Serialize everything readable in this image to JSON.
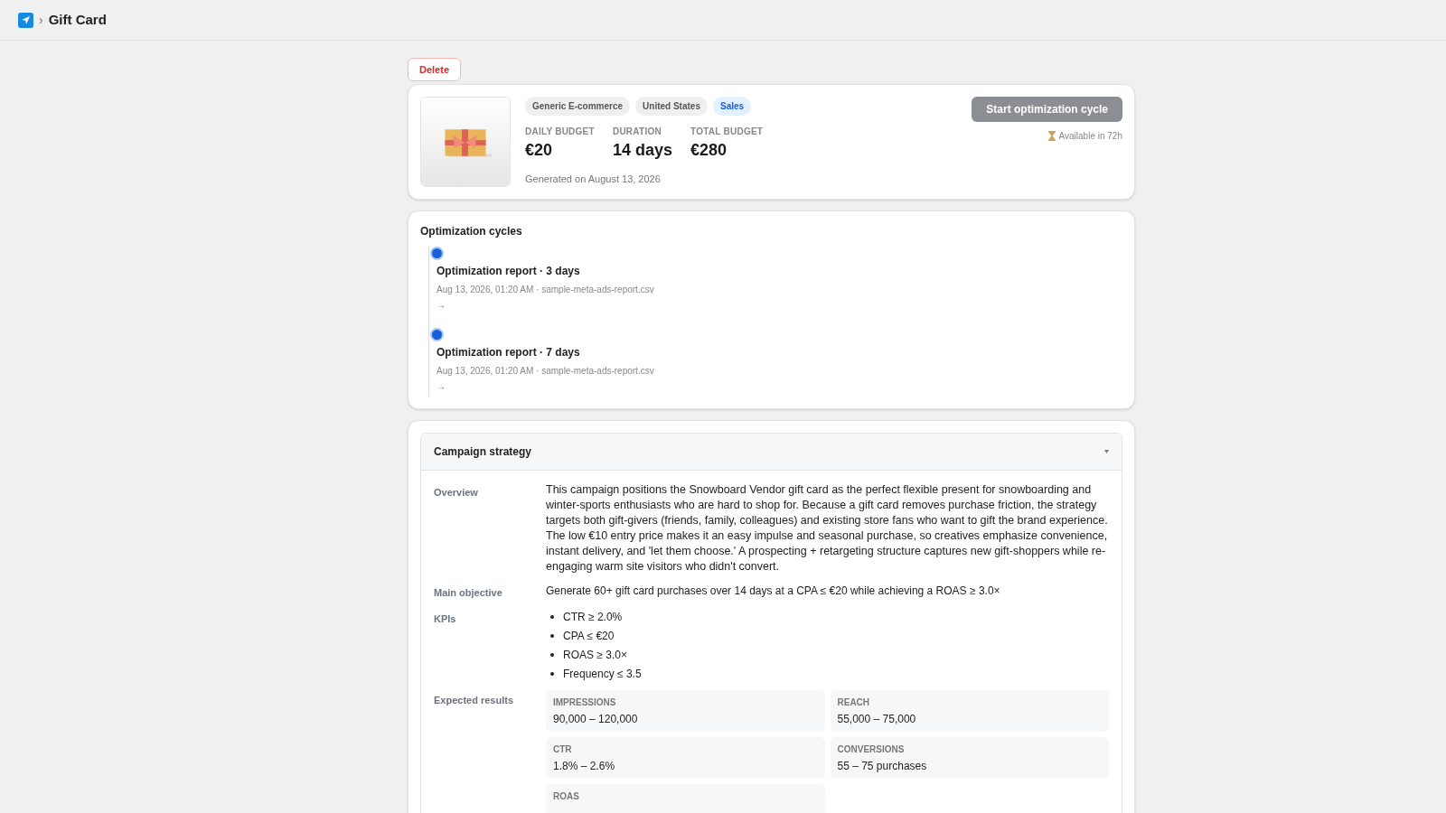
{
  "breadcrumb": {
    "title": "Gift Card",
    "separator": "›"
  },
  "delete_button": "Delete",
  "campaign": {
    "tags": [
      {
        "label": "Generic E-commerce",
        "highlighted": false
      },
      {
        "label": "United States",
        "highlighted": false
      },
      {
        "label": "Sales",
        "highlighted": true
      }
    ],
    "stats": [
      {
        "label": "DAILY BUDGET",
        "value": "€20"
      },
      {
        "label": "DURATION",
        "value": "14 days"
      },
      {
        "label": "TOTAL BUDGET",
        "value": "€280"
      }
    ],
    "generated": "Generated on August 13, 2026",
    "action": {
      "label": "Start optimization cycle",
      "disabled": true
    },
    "availability": "Available in 72h"
  },
  "cycles": {
    "title": "Optimization cycles",
    "items": [
      {
        "title": "Optimization report · 3 days",
        "meta": "Aug 13, 2026, 01:20 AM · sample-meta-ads-report.csv",
        "arrow": "→"
      },
      {
        "title": "Optimization report · 7 days",
        "meta": "Aug 13, 2026, 01:20 AM · sample-meta-ads-report.csv",
        "arrow": "→"
      }
    ]
  },
  "strategy": {
    "title": "Campaign strategy",
    "expanded": true,
    "overview_label": "Overview",
    "overview": "This campaign positions the Snowboard Vendor gift card as the perfect flexible present for snowboarding and winter-sports enthusiasts who are hard to shop for. Because a gift card removes purchase friction, the strategy targets both gift-givers (friends, family, colleagues) and existing store fans who want to gift the brand experience. The low €10 entry price makes it an easy impulse and seasonal purchase, so creatives emphasize convenience, instant delivery, and 'let them choose.' A prospecting + retargeting structure captures new gift-shoppers while re-engaging warm site visitors who didn't convert.",
    "objective_label": "Main objective",
    "objective": "Generate 60+ gift card purchases over 14 days at a CPA ≤ €20 while achieving a ROAS ≥ 3.0×",
    "kpis_label": "KPIs",
    "kpis": [
      "CTR ≥ 2.0%",
      "CPA ≤ €20",
      "ROAS ≥ 3.0×",
      "Frequency ≤ 3.5"
    ],
    "results_label": "Expected results",
    "results": [
      {
        "label": "IMPRESSIONS",
        "value": "90,000 – 120,000"
      },
      {
        "label": "REACH",
        "value": "55,000 – 75,000"
      },
      {
        "label": "CTR",
        "value": "1.8% – 2.6%"
      },
      {
        "label": "CONVERSIONS",
        "value": "55 – 75 purchases"
      },
      {
        "label": "ROAS"
      }
    ]
  }
}
